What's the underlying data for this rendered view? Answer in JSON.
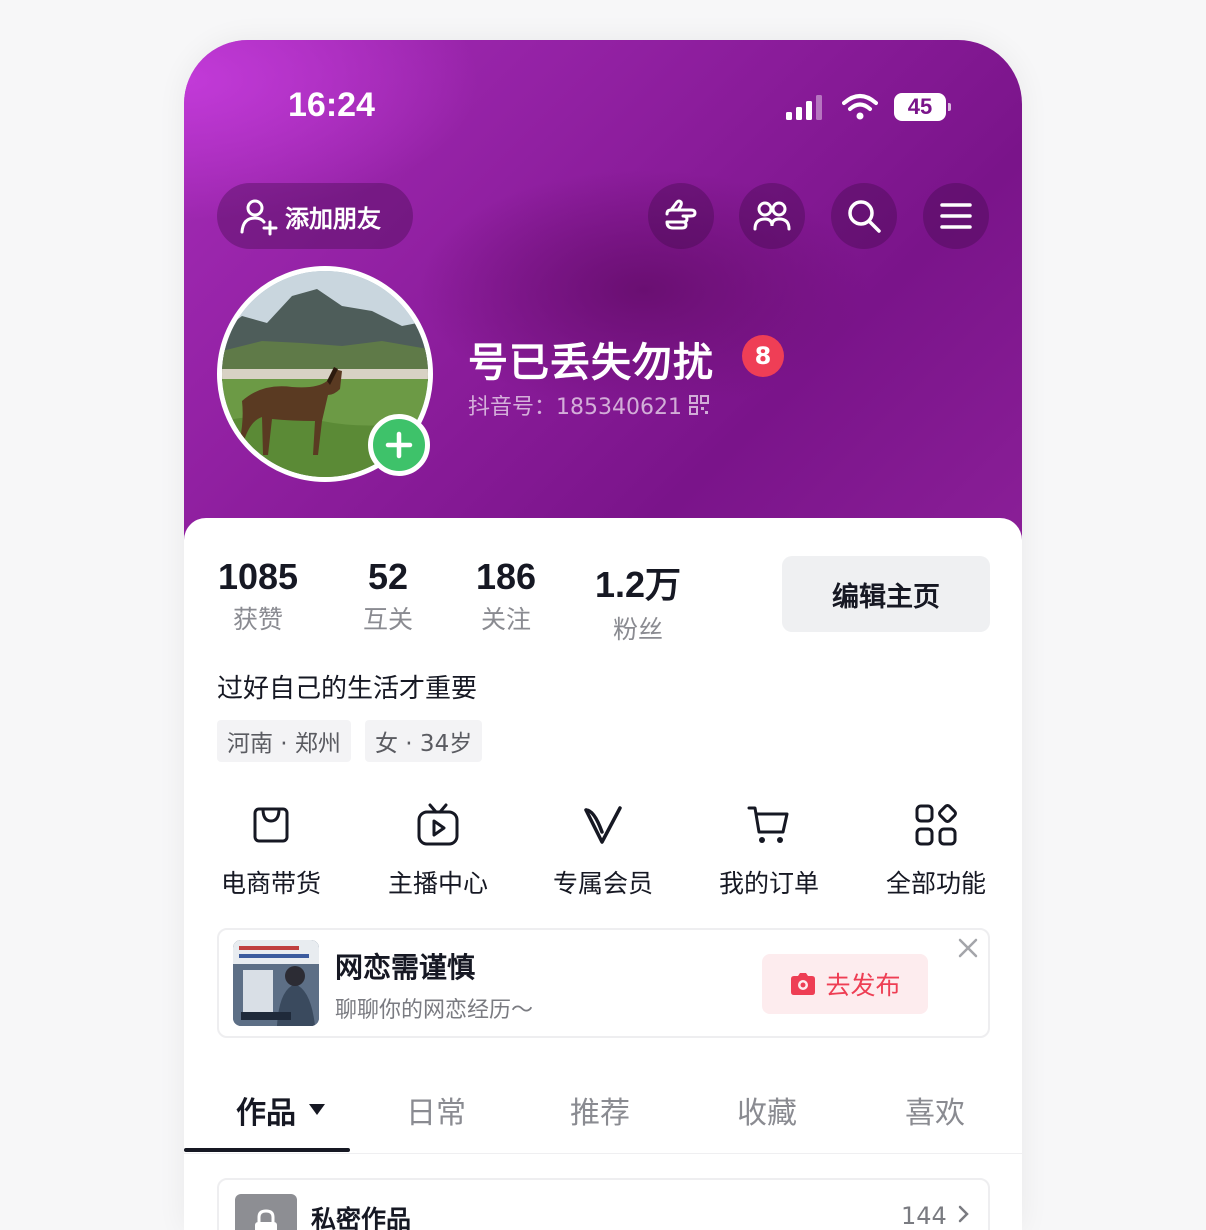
{
  "status_bar": {
    "time": "16:24",
    "battery": "45"
  },
  "header": {
    "add_friend_label": "添加朋友",
    "icons": [
      "hand-point-icon",
      "friends-icon",
      "search-icon",
      "menu-icon"
    ]
  },
  "profile": {
    "nickname": "号已丢失勿扰",
    "badge_count": "8",
    "douyin_id": "抖音号：185340621"
  },
  "stats": [
    {
      "value": "1085",
      "label": "获赞"
    },
    {
      "value": "52",
      "label": "互关"
    },
    {
      "value": "186",
      "label": "关注"
    },
    {
      "value": "1.2万",
      "label": "粉丝"
    }
  ],
  "edit_button": "编辑主页",
  "bio": "过好自己的生活才重要",
  "tags": [
    "河南 · 郑州",
    "女 · 34岁"
  ],
  "functions": [
    {
      "label": "电商带货",
      "icon": "shopping-bag-icon"
    },
    {
      "label": "主播中心",
      "icon": "tv-play-icon"
    },
    {
      "label": "专属会员",
      "icon": "vip-v-icon"
    },
    {
      "label": "我的订单",
      "icon": "cart-icon"
    },
    {
      "label": "全部功能",
      "icon": "grid-apps-icon"
    }
  ],
  "promo": {
    "title": "网恋需谨慎",
    "subtitle": "聊聊你的网恋经历～",
    "action": "去发布"
  },
  "tabs": [
    {
      "label": "作品",
      "active": true
    },
    {
      "label": "日常",
      "active": false
    },
    {
      "label": "推荐",
      "active": false
    },
    {
      "label": "收藏",
      "active": false
    },
    {
      "label": "喜欢",
      "active": false
    }
  ],
  "private_works": {
    "label": "私密作品",
    "count": "144"
  },
  "colors": {
    "header": "#8a1c9a",
    "badge": "#ef3e56",
    "plus": "#3ec26a",
    "publish": "#ee3e54"
  }
}
